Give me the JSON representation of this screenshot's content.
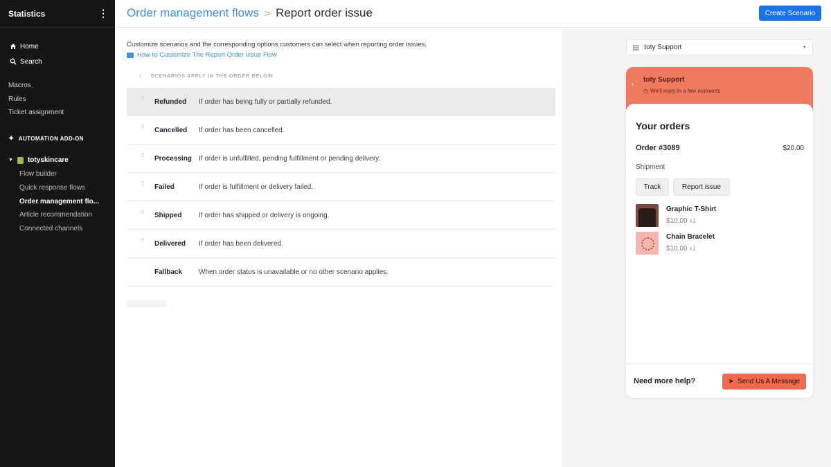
{
  "sidebar": {
    "title": "Statistics",
    "nav": [
      {
        "label": "Home",
        "icon": "home-icon"
      },
      {
        "label": "Search",
        "icon": "search-icon"
      }
    ],
    "links": [
      "Macros",
      "Rules",
      "Ticket assignment"
    ],
    "addon_label": "AUTOMATION ADD-ON",
    "store_name": "totyskincare",
    "store_items": [
      "Flow builder",
      "Quick response flows",
      "Order management flo...",
      "Article recommendation",
      "Connected channels"
    ],
    "active_item": "Order management flo..."
  },
  "header": {
    "breadcrumb_parent": "Order management flows",
    "breadcrumb_separator": ">",
    "breadcrumb_current": "Report order issue",
    "create_button": "Create Scenario",
    "accent_color": "#1a73e8"
  },
  "main": {
    "description": "Customize scenarios and the corresponding options customers can select when reporting order issues.",
    "help_link": "How to Customize The Report Order Issue Flow",
    "scenarios_header": "SCENARIOS APPLY IN THE ORDER BELOW",
    "scenarios": [
      {
        "name": "Refunded",
        "desc": "If order has being fully or partially refunded."
      },
      {
        "name": "Cancelled",
        "desc": "If order has been cancelled."
      },
      {
        "name": "Processing",
        "desc": "If order is unfulfilled, pending fulfillment or pending delivery."
      },
      {
        "name": "Failed",
        "desc": "If order is fulfillment or delivery failed."
      },
      {
        "name": "Shipped",
        "desc": "If order has shipped or delivery is ongoing."
      },
      {
        "name": "Delivered",
        "desc": "If order has been delivered."
      },
      {
        "name": "Fallback",
        "desc": "When order status is unavailable or no other scenario applies."
      }
    ]
  },
  "preview": {
    "channel": "toty Support",
    "widget_title": "toty Support",
    "widget_subtitle": "We'll reply in a few moments",
    "header_color": "#ef7a60",
    "orders_title": "Your orders",
    "order_number": "Order #3089",
    "order_total": "$20.00",
    "shipment_label": "Shipment",
    "track_button": "Track",
    "report_button": "Report issue",
    "products": [
      {
        "name": "Graphic T-Shirt",
        "price": "$10.00",
        "qty": "x1"
      },
      {
        "name": "Chain Bracelet",
        "price": "$10.00",
        "qty": "x1"
      }
    ],
    "help_text": "Need more help?",
    "send_button": "Send Us A Message"
  }
}
